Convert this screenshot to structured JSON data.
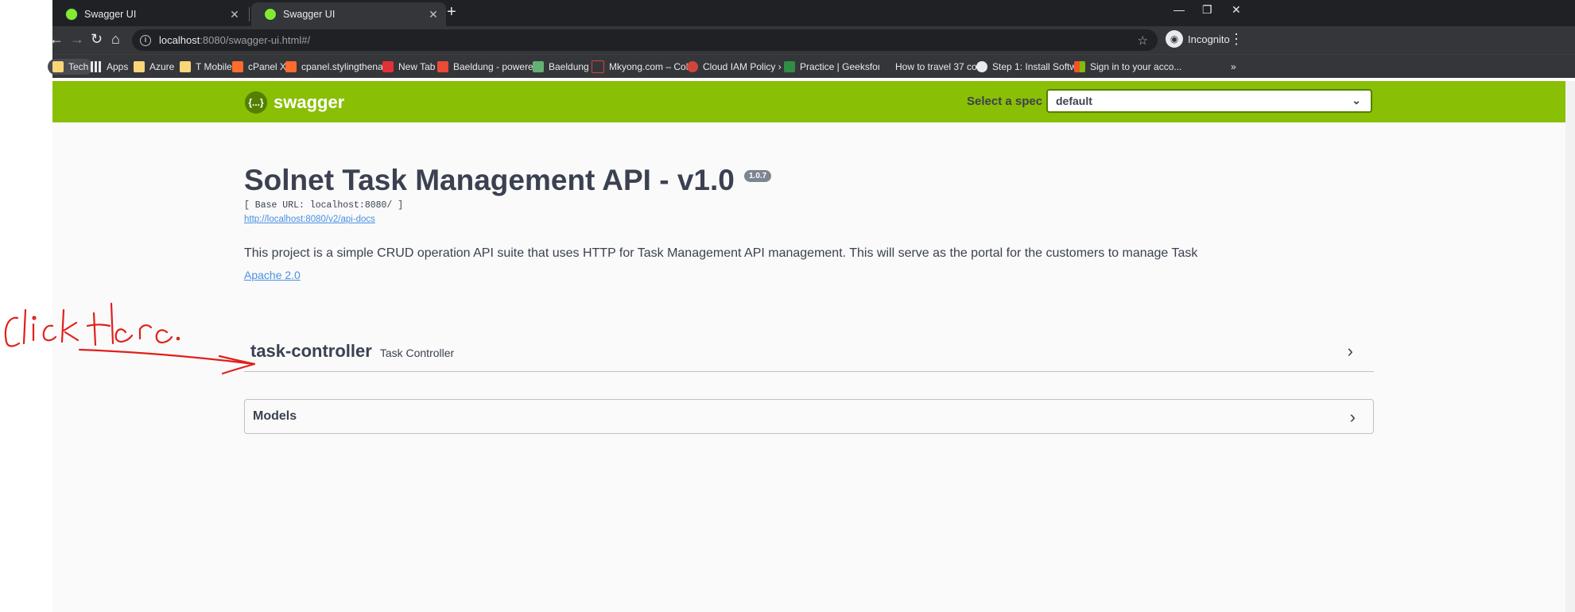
{
  "browser": {
    "tabs": [
      {
        "title": "Swagger UI",
        "close": "✕"
      },
      {
        "title": "Swagger UI",
        "close": "✕"
      }
    ],
    "url_host": "localhost",
    "url_rest": ":8080/swagger-ui.html#/",
    "profile": "Incognito",
    "bookmarks": [
      {
        "label": "Tech",
        "color": "#f9d67a"
      },
      {
        "label": "Apps",
        "color": "#e8eaed"
      },
      {
        "label": "Azure",
        "color": "#f9d67a"
      },
      {
        "label": "T Mobile",
        "color": "#f9d67a"
      },
      {
        "label": "cPanel X",
        "color": "#ff6c2c"
      },
      {
        "label": "cpanel.stylingthena...",
        "color": "#ff6c2c"
      },
      {
        "label": "New Tab",
        "color": "#e8eaed"
      },
      {
        "label": "Baeldung - powere...",
        "color": "#e94b35"
      },
      {
        "label": "Baeldung",
        "color": "#63b175"
      },
      {
        "label": "Mkyong.com – Coll...",
        "color": "#d0463b"
      },
      {
        "label": "Cloud IAM Policy › I...",
        "color": "#d0463b"
      },
      {
        "label": "Practice | Geeksfor...",
        "color": "#2f8d46"
      },
      {
        "label": "How to travel 37 co...",
        "color": "#35363a"
      },
      {
        "label": "Step 1: Install Softw...",
        "color": "#e8eaed"
      },
      {
        "label": "Sign in to your acco...",
        "color": "#f35325"
      }
    ]
  },
  "swagger": {
    "logo_text": "swagger",
    "spec_label": "Select a spec",
    "spec_value": "default",
    "title": "Solnet Task Management API - v1.0",
    "version": "1.0.7",
    "base_url": "[ Base URL: localhost:8080/ ]",
    "api_docs_link": "http://localhost:8080/v2/api-docs",
    "description": "This project is a simple CRUD operation API suite that uses HTTP for Task Management API management. This will serve as the portal for the customers to manage Task",
    "license": "Apache 2.0",
    "tag": {
      "name": "task-controller",
      "description": "Task Controller"
    },
    "models_label": "Models"
  }
}
